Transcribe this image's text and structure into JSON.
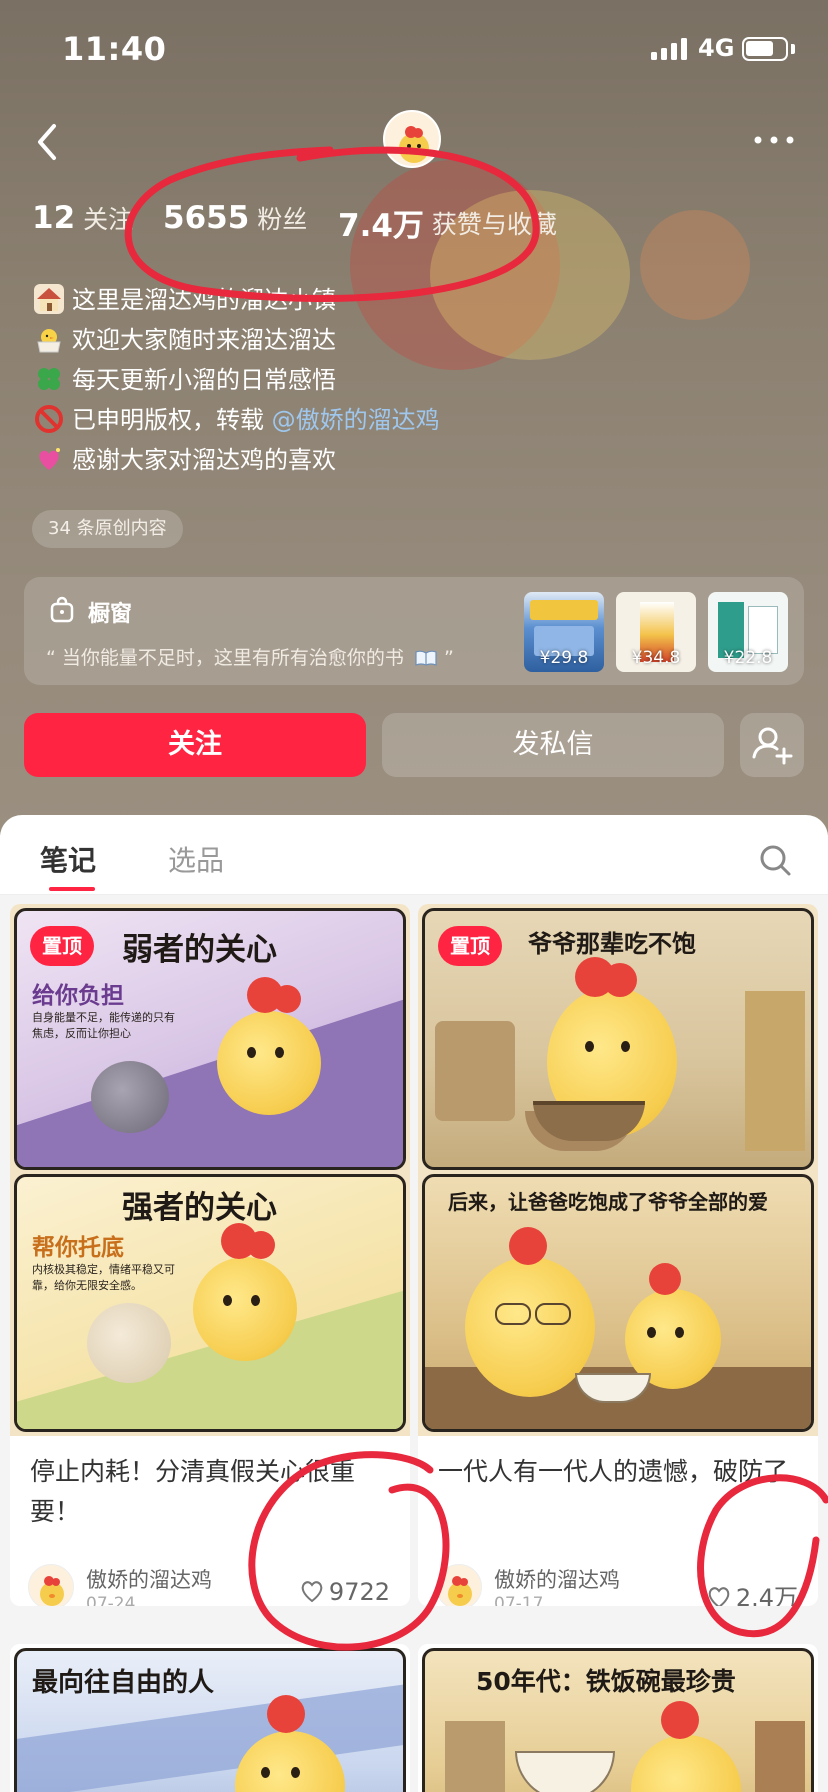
{
  "status_bar": {
    "time": "11:40",
    "network": "4G"
  },
  "stats": [
    {
      "num": "12",
      "label": "关注"
    },
    {
      "num": "5655",
      "label": "粉丝"
    },
    {
      "num": "7.4万",
      "label": "获赞与收藏"
    }
  ],
  "bio": {
    "line1": "这里是溜达鸡的溜达小镇",
    "line2": "欢迎大家随时来溜达溜达",
    "line3": "每天更新小溜的日常感悟",
    "line4_prefix": "已申明版权，转载 ",
    "line4_mention": "@傲娇的溜达鸡",
    "line5": "感谢大家对溜达鸡的喜欢"
  },
  "original_tag": "34 条原创内容",
  "shop": {
    "title": "橱窗",
    "subtitle": "“ 当你能量不足时，这里有所有治愈你的书",
    "subtitle_end": " ”",
    "products": [
      {
        "price": "¥29.8"
      },
      {
        "price": "¥34.8"
      },
      {
        "price": "¥22.8"
      }
    ]
  },
  "actions": {
    "follow": "关注",
    "message": "发私信"
  },
  "tabs": [
    {
      "label": "笔记",
      "active": true
    },
    {
      "label": "选品",
      "active": false
    }
  ],
  "posts": [
    {
      "pin": "置顶",
      "cover_title_top": "弱者的关心",
      "cover_sub_top": "给你负担",
      "cover_small_top": "自身能量不足，能传递的只有焦虑，反而让你担心",
      "cover_title_bottom": "强者的关心",
      "cover_sub_bottom": "帮你托底",
      "cover_small_bottom": "内核极其稳定，情绪平稳又可靠，给你无限安全感。",
      "title": "停止内耗！分清真假关心很重要！",
      "author": "傲娇的溜达鸡",
      "date": "07-24",
      "likes": "9722"
    },
    {
      "pin": "置顶",
      "cover_title_top": "爷爷那辈吃不饱",
      "cover_title_bottom": "后来，让爸爸吃饱成了爷爷全部的爱",
      "title": "一代人有一代人的遗憾，破防了",
      "author": "傲娇的溜达鸡",
      "date": "07-17",
      "likes": "2.4万"
    },
    {
      "cover_title_top": "最向往自由的人"
    },
    {
      "cover_title_top": "50年代：铁饭碗最珍贵"
    }
  ],
  "colors": {
    "brand": "#ff2442",
    "annotation": "#e8283c"
  }
}
